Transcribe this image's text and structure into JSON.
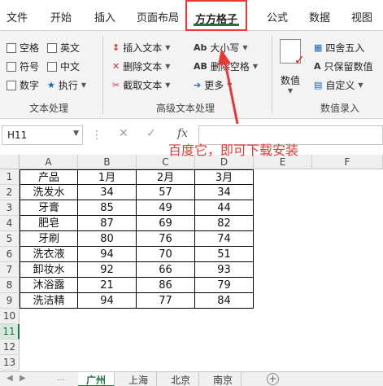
{
  "tabs": [
    "文件",
    "开始",
    "插入",
    "页面布局",
    "方方格子",
    "公式",
    "数据",
    "视图"
  ],
  "ribbon": {
    "text_group": {
      "items": [
        "空格",
        "英文",
        "符号",
        "中文",
        "数字"
      ],
      "execute": "执行",
      "label": "文本处理"
    },
    "advanced_group": {
      "items": [
        "插入文本",
        "删除文本",
        "截取文本"
      ],
      "size_items": [
        "大小写",
        "删除空格",
        "更多"
      ],
      "label": "高级文本处理",
      "icon_letters": "Ab",
      "icon_letters_b": "AB"
    },
    "numeric_group": {
      "value_button": "数值",
      "round": "四舍五入",
      "keep_value": "只保留数值",
      "custom": "自定义",
      "label": "数值录入"
    }
  },
  "formula_bar": {
    "name_box": "H11",
    "cancel": "✕",
    "confirm": "✓",
    "fx": "fx",
    "value": ""
  },
  "annotation": "百度它，即可下载安装",
  "columns": [
    "A",
    "B",
    "C",
    "D",
    "E",
    "F"
  ],
  "rows": [
    "1",
    "2",
    "3",
    "4",
    "5",
    "6",
    "7",
    "8",
    "9",
    "10",
    "11",
    "12",
    "13"
  ],
  "table": {
    "header": [
      "产品",
      "1月",
      "2月",
      "3月"
    ],
    "rows": [
      [
        "洗发水",
        "34",
        "57",
        "34"
      ],
      [
        "牙膏",
        "85",
        "49",
        "44"
      ],
      [
        "肥皂",
        "87",
        "69",
        "82"
      ],
      [
        "牙刷",
        "80",
        "76",
        "74"
      ],
      [
        "洗衣液",
        "94",
        "70",
        "51"
      ],
      [
        "卸妆水",
        "92",
        "66",
        "93"
      ],
      [
        "沐浴露",
        "21",
        "86",
        "79"
      ],
      [
        "洗洁精",
        "94",
        "77",
        "84"
      ]
    ]
  },
  "selected_row": "11",
  "sheets": [
    "广州",
    "上海",
    "北京",
    "南京"
  ],
  "active_sheet": "广州",
  "add_sheet": "+",
  "colors": {
    "accent": "#217346",
    "highlight": "#e53935"
  }
}
